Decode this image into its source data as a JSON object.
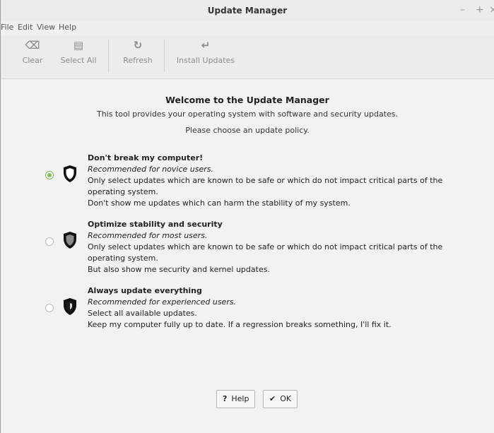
{
  "window": {
    "title": "Update Manager",
    "minimize_glyph": "–",
    "maximize_glyph": "+",
    "close_glyph": "×"
  },
  "menu": [
    "File",
    "Edit",
    "View",
    "Help"
  ],
  "toolbar": [
    {
      "label": "Clear",
      "icon": "clear-icon",
      "glyph": "⌫"
    },
    {
      "label": "Select All",
      "icon": "select-all-icon",
      "glyph": "▤"
    },
    {
      "label": "Refresh",
      "icon": "refresh-icon",
      "glyph": "↻"
    },
    {
      "label": "Install Updates",
      "icon": "install-updates-icon",
      "glyph": "↵"
    }
  ],
  "main": {
    "heading": "Welcome to the Update Manager",
    "intro": "This tool provides your operating system with software and security updates.",
    "prompt": "Please choose an update policy."
  },
  "options": [
    {
      "title": "Don't break my computer!",
      "subtitle": "Recommended for novice users.",
      "line1": "Only select updates which are known to be safe or which do not impact critical parts of the operating system.",
      "line2": "Don't show me updates which can harm the stability of my system.",
      "selected": true,
      "shield_fill": "#ffffff"
    },
    {
      "title": "Optimize stability and security",
      "subtitle": "Recommended for most users.",
      "line1": "Only select updates which are known to be safe or which do not impact critical parts of the operating system.",
      "line2": "But also show me security and kernel updates.",
      "selected": false,
      "shield_fill": "#8a8a8a"
    },
    {
      "title": "Always update everything",
      "subtitle": "Recommended for experienced users.",
      "line1": "Select all available updates.",
      "line2": "Keep my computer fully up to date. If a regression breaks something, I'll fix it.",
      "selected": false,
      "shield_fill": "#1a1a1a"
    }
  ],
  "buttons": {
    "help_label": "Help",
    "ok_label": "OK"
  }
}
